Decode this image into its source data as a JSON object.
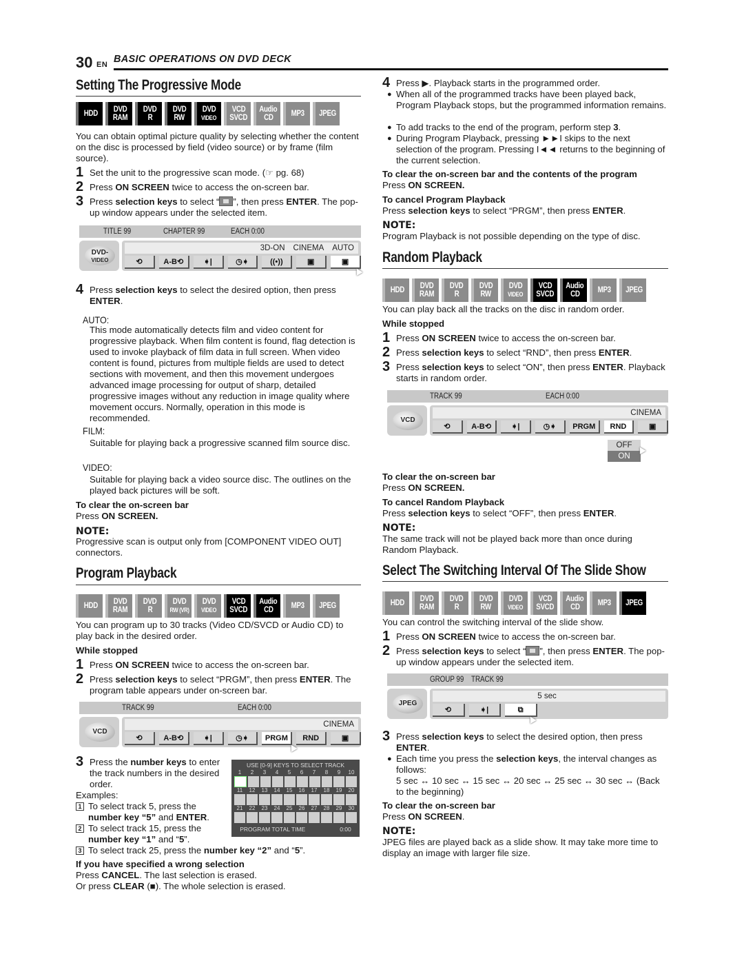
{
  "header": {
    "page_number": "30",
    "lang": "EN",
    "section": "BASIC OPERATIONS ON DVD DECK"
  },
  "disc_types": [
    "HDD",
    "DVD|RAM",
    "DVD|R",
    "DVD|RW",
    "DVD|VIDEO",
    "VCD|SVCD",
    "Audio|CD",
    "MP3",
    "JPEG"
  ],
  "progressive": {
    "title": "Setting The Progressive Mode",
    "badges": [
      {
        "l1": "HDD",
        "l2": "",
        "on": true
      },
      {
        "l1": "DVD",
        "l2": "RAM",
        "on": true
      },
      {
        "l1": "DVD",
        "l2": "R",
        "on": true
      },
      {
        "l1": "DVD",
        "l2": "RW",
        "on": true
      },
      {
        "l1": "DVD",
        "l2": "VIDEO",
        "on": true
      },
      {
        "l1": "VCD",
        "l2": "SVCD",
        "on": false
      },
      {
        "l1": "Audio",
        "l2": "CD",
        "on": false
      },
      {
        "l1": "MP3",
        "l2": "",
        "on": false
      },
      {
        "l1": "JPEG",
        "l2": "",
        "on": false
      }
    ],
    "intro": "You can obtain optimal picture quality by selecting whether the content on the disc is processed by field (video source) or by frame (film source).",
    "step1": "Set the unit to the progressive scan mode. (☞ pg. 68)",
    "step2_a": "Press ",
    "step2_b": "ON SCREEN",
    "step2_c": " twice to access the on-screen bar.",
    "step3_a": "Press ",
    "step3_b": "selection keys",
    "step3_c": " to select “",
    "step3_d": "”, then press ",
    "step3_e": "ENTER",
    "step3_f": ". The pop-up window appears under the selected item.",
    "osd": {
      "title": "TITLE 99",
      "chapter": "CHAPTER 99",
      "each": "EACH 0:00",
      "disc": "DVD-\nVIDEO",
      "info": [
        "3D-ON",
        "CINEMA",
        "AUTO"
      ],
      "buttons": [
        "⟲",
        "A-B⟲",
        "➧|",
        "◷➧",
        "((•))",
        "▣",
        "▣"
      ]
    },
    "step4_a": "Press ",
    "step4_b": "selection keys",
    "step4_c": " to select the desired option, then press ",
    "step4_d": "ENTER",
    "step4_e": ".",
    "auto_label": "AUTO:",
    "auto_text": "This mode automatically detects film and video content for progressive playback. When film content is found, flag detection is used to invoke playback of film data in full screen. When video content is found, pictures from multiple fields are used to detect sections with movement, and then this movement undergoes advanced image processing for output of sharp, detailed progressive images without any reduction in image quality where movement occurs. Normally, operation in this mode is recommended.",
    "film_label": "FILM:",
    "film_text": "Suitable for playing back a progressive scanned film source disc.",
    "video_label": "VIDEO:",
    "video_text": "Suitable for playing back a video source disc. The outlines on the played back pictures will be soft.",
    "clear_heading": "To clear the on-screen bar",
    "clear_a": "Press ",
    "clear_b": "ON SCREEN.",
    "note_label": "NOTE:",
    "note_text": "Progressive scan is output only from [COMPONENT VIDEO OUT] connectors."
  },
  "program": {
    "title": "Program Playback",
    "badges": [
      {
        "l1": "HDD",
        "l2": "",
        "on": false
      },
      {
        "l1": "DVD",
        "l2": "RAM",
        "on": false
      },
      {
        "l1": "DVD",
        "l2": "R",
        "on": false
      },
      {
        "l1": "DVD",
        "l2": "RW (VR)",
        "on": false
      },
      {
        "l1": "DVD",
        "l2": "VIDEO",
        "on": false
      },
      {
        "l1": "VCD",
        "l2": "SVCD",
        "on": true
      },
      {
        "l1": "Audio",
        "l2": "CD",
        "on": true
      },
      {
        "l1": "MP3",
        "l2": "",
        "on": false
      },
      {
        "l1": "JPEG",
        "l2": "",
        "on": false
      }
    ],
    "intro": "You can program up to 30 tracks (Video CD/SVCD or Audio CD) to play back in the desired order.",
    "while_stopped": "While stopped",
    "step1_a": "Press ",
    "step1_b": "ON SCREEN",
    "step1_c": " twice to access the on-screen bar.",
    "step2_a": "Press ",
    "step2_b": "selection keys",
    "step2_c": " to select “PRGM”, then press ",
    "step2_d": "ENTER",
    "step2_e": ". The program table appears under on-screen bar.",
    "osd": {
      "track": "TRACK 99",
      "each": "EACH 0:00",
      "disc": "VCD",
      "info": [
        "CINEMA"
      ],
      "buttons": [
        "⟲",
        "A-B⟲",
        "➧|",
        "◷➧",
        "PRGM",
        "RND",
        "▣"
      ]
    },
    "step3_a": "Press the ",
    "step3_b": "number keys",
    "step3_c": " to enter the track numbers in the desired order.",
    "examples": "Examples:",
    "ex1_a": "To select track 5, press the ",
    "ex1_b": "number key “5”",
    "ex1_c": " and ",
    "ex1_d": "ENTER",
    "ex1_e": ".",
    "ex2_a": "To select track 15, press the ",
    "ex2_b": "number key “1”",
    "ex2_c": " and “",
    "ex2_d": "5",
    "ex2_e": "”.",
    "ex3_a": "To select track 25, press the ",
    "ex3_b": "number key “2”",
    "ex3_c": " and “",
    "ex3_d": "5",
    "ex3_e": "”.",
    "table": {
      "title": "USE [0-9] KEYS TO SELECT TRACK",
      "footer_label": "PROGRAM TOTAL TIME",
      "footer_value": "0:00",
      "track_count": 30
    },
    "wrong_heading": "If you have specified a wrong selection",
    "wrong1_a": "Press ",
    "wrong1_b": "CANCEL",
    "wrong1_c": ". The last selection is erased.",
    "wrong2_a": "Or press ",
    "wrong2_b": "CLEAR",
    "wrong2_c": " (■). The whole selection is erased.",
    "step4_a": "Press ▶. Playback starts in the programmed order.",
    "b1": "When all of the programmed tracks have been played back, Program Playback stops, but the programmed information remains.",
    "b2_a": "To add tracks to the end of the program, perform step ",
    "b2_b": "3",
    "b2_c": ".",
    "b3": "During Program Playback, pressing ►►I skips to the next selection of the program. Pressing I◄◄ returns to the beginning of the current selection.",
    "clear_heading": "To clear the on-screen bar and the contents of the program",
    "clear_a": "Press ",
    "clear_b": "ON SCREEN.",
    "cancel_heading": "To cancel Program Playback",
    "cancel_a": "Press ",
    "cancel_b": "selection keys",
    "cancel_c": " to select “PRGM”, then press ",
    "cancel_d": "ENTER",
    "cancel_e": ".",
    "note_label": "NOTE:",
    "note_text": "Program Playback is not possible depending on the type of disc."
  },
  "random": {
    "title": "Random Playback",
    "badges": [
      {
        "l1": "HDD",
        "l2": "",
        "on": false
      },
      {
        "l1": "DVD",
        "l2": "RAM",
        "on": false
      },
      {
        "l1": "DVD",
        "l2": "R",
        "on": false
      },
      {
        "l1": "DVD",
        "l2": "RW",
        "on": false
      },
      {
        "l1": "DVD",
        "l2": "VIDEO",
        "on": false
      },
      {
        "l1": "VCD",
        "l2": "SVCD",
        "on": true
      },
      {
        "l1": "Audio",
        "l2": "CD",
        "on": true
      },
      {
        "l1": "MP3",
        "l2": "",
        "on": false
      },
      {
        "l1": "JPEG",
        "l2": "",
        "on": false
      }
    ],
    "intro": "You can play back all the tracks on the disc in random order.",
    "while_stopped": "While stopped",
    "step1_a": "Press ",
    "step1_b": "ON SCREEN",
    "step1_c": " twice to access the on-screen bar.",
    "step2_a": "Press ",
    "step2_b": "selection keys",
    "step2_c": " to select “RND”, then press ",
    "step2_d": "ENTER",
    "step2_e": ".",
    "step3_a": "Press ",
    "step3_b": "selection keys",
    "step3_c": " to select “ON”, then press ",
    "step3_d": "ENTER",
    "step3_e": ". Playback starts in random order.",
    "osd": {
      "track": "TRACK 99",
      "each": "EACH 0:00",
      "disc": "VCD",
      "info": [
        "CINEMA"
      ],
      "buttons": [
        "⟲",
        "A-B⟲",
        "➧|",
        "◷➧",
        "PRGM",
        "RND",
        "▣"
      ],
      "popup": [
        "OFF",
        "ON"
      ]
    },
    "clear_heading": "To clear the on-screen bar",
    "clear_a": "Press ",
    "clear_b": "ON SCREEN.",
    "cancel_heading": "To cancel Random Playback",
    "cancel_a": "Press ",
    "cancel_b": "selection keys",
    "cancel_c": " to select “OFF”, then press ",
    "cancel_d": "ENTER",
    "cancel_e": ".",
    "note_label": "NOTE:",
    "note_text": "The same track will not be played back more than once during Random Playback."
  },
  "slideshow": {
    "title": "Select The Switching Interval Of The Slide Show",
    "badges": [
      {
        "l1": "HDD",
        "l2": "",
        "on": false
      },
      {
        "l1": "DVD",
        "l2": "RAM",
        "on": false
      },
      {
        "l1": "DVD",
        "l2": "R",
        "on": false
      },
      {
        "l1": "DVD",
        "l2": "RW",
        "on": false
      },
      {
        "l1": "DVD",
        "l2": "VIDEO",
        "on": false
      },
      {
        "l1": "VCD",
        "l2": "SVCD",
        "on": false
      },
      {
        "l1": "Audio",
        "l2": "CD",
        "on": false
      },
      {
        "l1": "MP3",
        "l2": "",
        "on": false
      },
      {
        "l1": "JPEG",
        "l2": "",
        "on": true
      }
    ],
    "intro": "You can control the switching interval of the slide show.",
    "step1_a": "Press ",
    "step1_b": "ON SCREEN",
    "step1_c": " twice to access the on-screen bar.",
    "step2_a": "Press ",
    "step2_b": "selection keys",
    "step2_c": " to select “",
    "step2_d": "”, then press ",
    "step2_e": "ENTER",
    "step2_f": ". The pop-up window appears under the selected item.",
    "osd": {
      "group": "GROUP 99",
      "track": "TRACK 99",
      "disc": "JPEG",
      "info": "5 sec",
      "buttons": [
        "⟲",
        "➧|",
        "⧉"
      ]
    },
    "step3_a": "Press ",
    "step3_b": "selection keys",
    "step3_c": " to select the desired option, then press ",
    "step3_d": "ENTER",
    "step3_e": ".",
    "b1_a": "Each time you press the ",
    "b1_b": "selection keys",
    "b1_c": ", the interval changes as follows:",
    "sequence": "5 sec ↔ 10 sec ↔ 15 sec ↔ 20 sec ↔ 25 sec ↔ 30 sec ↔ (Back to the beginning)",
    "clear_heading": "To clear the on-screen bar",
    "clear_a": "Press ",
    "clear_b": "ON SCREEN",
    "clear_c": ".",
    "note_label": "NOTE:",
    "note_text": "JPEG files are played back as a slide show. It may take more time to display an image with larger file size."
  }
}
